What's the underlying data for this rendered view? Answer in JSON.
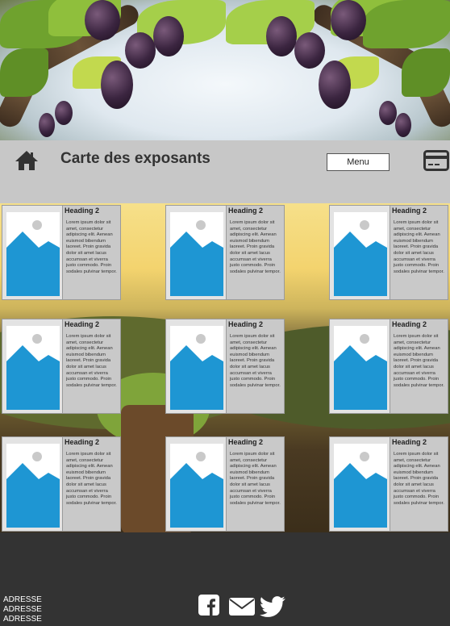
{
  "header": {
    "title": "Carte des exposants",
    "menu_label": "Menu"
  },
  "icons": {
    "home": "home-icon",
    "card": "credit-card-icon",
    "facebook": "facebook-icon",
    "email": "envelope-icon",
    "twitter": "twitter-icon"
  },
  "exhibitors": [
    {
      "heading": "Heading 2",
      "text": "Lorem ipsum dolor sit amet, consectetur adipiscing elit. Aenean euismod bibendum laoreet. Proin gravida dolor sit amet lacus accumsan et viverra justo commodo. Proin sodales pulvinar tempor."
    },
    {
      "heading": "Heading 2",
      "text": "Lorem ipsum dolor sit amet, consectetur adipiscing elit. Aenean euismod bibendum laoreet. Proin gravida dolor sit amet lacus accumsan et viverra justo commodo. Proin sodales pulvinar tempor."
    },
    {
      "heading": "Heading 2",
      "text": "Lorem ipsum dolor sit amet, consectetur adipiscing elit. Aenean euismod bibendum laoreet. Proin gravida dolor sit amet lacus accumsan et viverra justo commodo. Proin sodales pulvinar tempor."
    },
    {
      "heading": "Heading 2",
      "text": "Lorem ipsum dolor sit amet, consectetur adipiscing elit. Aenean euismod bibendum laoreet. Proin gravida dolor sit amet lacus accumsan et viverra justo commodo. Proin sodales pulvinar tempor."
    },
    {
      "heading": "Heading 2",
      "text": "Lorem ipsum dolor sit amet, consectetur adipiscing elit. Aenean euismod bibendum laoreet. Proin gravida dolor sit amet lacus accumsan et viverra justo commodo. Proin sodales pulvinar tempor."
    },
    {
      "heading": "Heading 2",
      "text": "Lorem ipsum dolor sit amet, consectetur adipiscing elit. Aenean euismod bibendum laoreet. Proin gravida dolor sit amet lacus accumsan et viverra justo commodo. Proin sodales pulvinar tempor."
    },
    {
      "heading": "Heading 2",
      "text": "Lorem ipsum dolor sit amet, consectetur adipiscing elit. Aenean euismod bibendum laoreet. Proin gravida dolor sit amet lacus accumsan et viverra justo commodo. Proin sodales pulvinar tempor."
    },
    {
      "heading": "Heading 2",
      "text": "Lorem ipsum dolor sit amet, consectetur adipiscing elit. Aenean euismod bibendum laoreet. Proin gravida dolor sit amet lacus accumsan et viverra justo commodo. Proin sodales pulvinar tempor."
    },
    {
      "heading": "Heading 2",
      "text": "Lorem ipsum dolor sit amet, consectetur adipiscing elit. Aenean euismod bibendum laoreet. Proin gravida dolor sit amet lacus accumsan et viverra justo commodo. Proin sodales pulvinar tempor."
    }
  ],
  "footer": {
    "address_lines": [
      "ADRESSE",
      "ADRESSE",
      "ADRESSE"
    ]
  },
  "colors": {
    "header_bg": "#c7c7c7",
    "footer_bg": "#333333",
    "placeholder_blue": "#1e96d3",
    "card_body_bg": "#c9c9c9"
  }
}
